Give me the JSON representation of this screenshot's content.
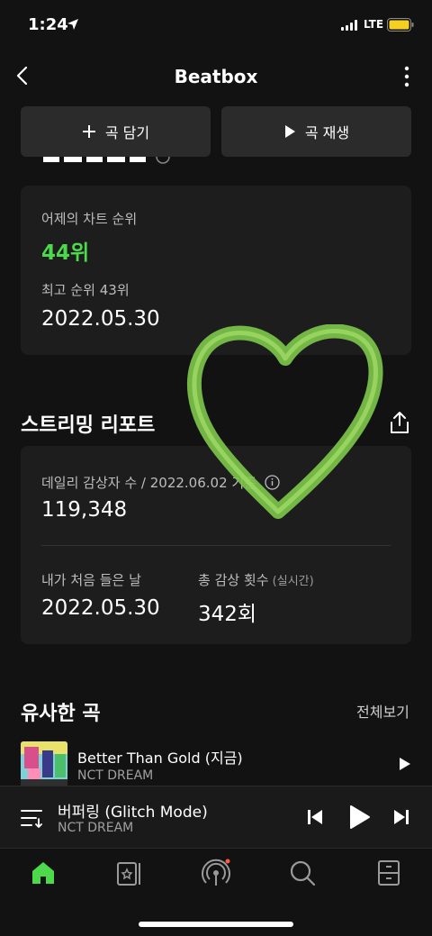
{
  "status_bar": {
    "time": "1:24",
    "network": "LTE"
  },
  "nav": {
    "title": "Beatbox"
  },
  "actions": {
    "add_song_label": "곡 담기",
    "play_song_label": "곡 재생"
  },
  "chart_card": {
    "yesterday_label": "어제의 차트 순위",
    "yesterday_rank": "44위",
    "peak_label": "최고 순위 43위",
    "peak_date": "2022.05.30"
  },
  "streaming": {
    "title": "스트리밍 리포트",
    "daily_label": "데일리 감상자 수",
    "daily_date": " / 2022.06.02 기준",
    "daily_count": "119,348",
    "first_listen_label": "내가 처음 들은 날",
    "first_listen_date": "2022.05.30",
    "total_plays_label": "총 감상 횟수",
    "total_plays_suffix": " (실시간)",
    "total_plays": "342회"
  },
  "similar": {
    "title": "유사한 곡",
    "see_all": "전체보기",
    "items": [
      {
        "title": "Better Than Gold (지금)",
        "artist": "NCT DREAM"
      }
    ]
  },
  "mini_player": {
    "title": "버퍼링 (Glitch Mode)",
    "artist": "NCT DREAM"
  },
  "colors": {
    "accent": "#4cd94c",
    "background": "#121212",
    "card": "#1d1d1d"
  }
}
